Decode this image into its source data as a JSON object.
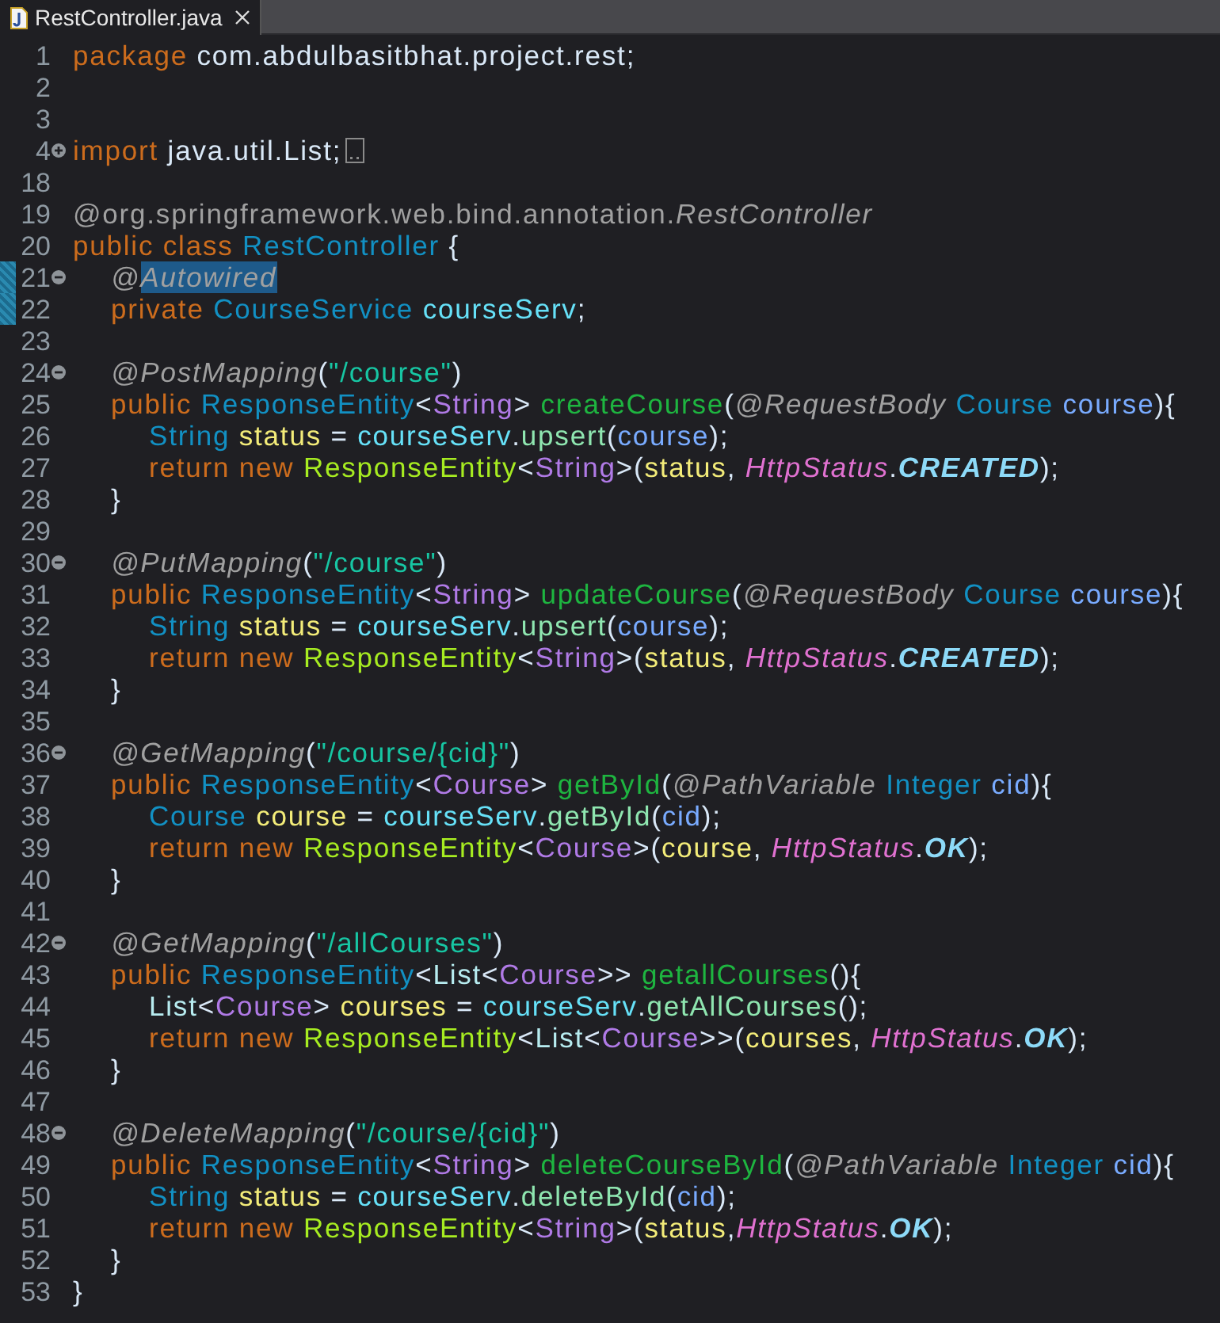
{
  "tab": {
    "title": "RestController.java",
    "selected": true
  },
  "lines": [
    {
      "number": "1",
      "kind": "top",
      "tokens": [
        {
          "text": "package ",
          "kind": "keyword"
        },
        {
          "text": "com.abdulbasitbhat.project.rest;",
          "kind": "plain"
        }
      ]
    },
    {
      "number": "2",
      "kind": "top"
    },
    {
      "number": "3",
      "kind": "top"
    },
    {
      "number": "4",
      "kind": "top",
      "collapsed": true,
      "tokens": [
        {
          "text": "import ",
          "kind": "keyword"
        },
        {
          "text": "java.util.List;",
          "kind": "plain"
        }
      ]
    },
    {
      "number": "18",
      "kind": "top"
    },
    {
      "number": "19",
      "kind": "top",
      "tokens": [
        {
          "text": "@org.springframework.web.bind.annotation.",
          "kind": "annotation-path"
        },
        {
          "text": "RestController",
          "kind": "annotation"
        }
      ]
    },
    {
      "number": "20",
      "kind": "top",
      "tokens": [
        {
          "text": "public class ",
          "kind": "keyword"
        },
        {
          "text": "RestController",
          "kind": "type"
        },
        {
          "text": " {",
          "kind": "plain"
        }
      ]
    },
    {
      "number": "21",
      "kind": "member",
      "collapsed": false,
      "marked": true,
      "tokens": [
        {
          "text": "@",
          "kind": "annotation"
        },
        {
          "text": "Autowired",
          "kind": "annotation",
          "highlighted": true
        }
      ]
    },
    {
      "number": "22",
      "kind": "member",
      "marked": true,
      "tokens": [
        {
          "text": "private ",
          "kind": "keyword"
        },
        {
          "text": "CourseService ",
          "kind": "type"
        },
        {
          "text": "courseServ",
          "kind": "field"
        },
        {
          "text": ";",
          "kind": "plain"
        }
      ]
    },
    {
      "number": "23",
      "kind": "top"
    },
    {
      "number": "24",
      "kind": "member",
      "collapsed": false,
      "tokens": [
        {
          "text": "@PostMapping",
          "kind": "annotation"
        },
        {
          "text": "(",
          "kind": "plain"
        },
        {
          "text": "\"/course\"",
          "kind": "string"
        },
        {
          "text": ")",
          "kind": "plain"
        }
      ]
    },
    {
      "number": "25",
      "kind": "member",
      "tokens": [
        {
          "text": "public ",
          "kind": "keyword"
        },
        {
          "text": "ResponseEntity",
          "kind": "type"
        },
        {
          "text": "<",
          "kind": "plain"
        },
        {
          "text": "String",
          "kind": "generic"
        },
        {
          "text": "> ",
          "kind": "plain"
        },
        {
          "text": "createCourse",
          "kind": "method"
        },
        {
          "text": "(",
          "kind": "plain"
        },
        {
          "text": "@RequestBody ",
          "kind": "annotation"
        },
        {
          "text": "Course ",
          "kind": "type"
        },
        {
          "text": "course",
          "kind": "param"
        },
        {
          "text": "){",
          "kind": "plain"
        }
      ]
    },
    {
      "number": "26",
      "kind": "statement",
      "tokens": [
        {
          "text": "String ",
          "kind": "type"
        },
        {
          "text": "status",
          "kind": "variable"
        },
        {
          "text": " = ",
          "kind": "plain"
        },
        {
          "text": "courseServ",
          "kind": "field"
        },
        {
          "text": ".",
          "kind": "plain"
        },
        {
          "text": "upsert",
          "kind": "call"
        },
        {
          "text": "(",
          "kind": "plain"
        },
        {
          "text": "course",
          "kind": "param"
        },
        {
          "text": ");",
          "kind": "plain"
        }
      ]
    },
    {
      "number": "27",
      "kind": "statement",
      "tokens": [
        {
          "text": "return new ",
          "kind": "keyword"
        },
        {
          "text": "ResponseEntity",
          "kind": "constructor"
        },
        {
          "text": "<",
          "kind": "plain"
        },
        {
          "text": "String",
          "kind": "generic"
        },
        {
          "text": ">(",
          "kind": "plain"
        },
        {
          "text": "status",
          "kind": "variable"
        },
        {
          "text": ", ",
          "kind": "plain"
        },
        {
          "text": "HttpStatus",
          "kind": "static"
        },
        {
          "text": ".",
          "kind": "plain"
        },
        {
          "text": "CREATED",
          "kind": "constant"
        },
        {
          "text": ");",
          "kind": "plain"
        }
      ]
    },
    {
      "number": "28",
      "kind": "member",
      "tokens": [
        {
          "text": "}",
          "kind": "plain"
        }
      ]
    },
    {
      "number": "29",
      "kind": "top"
    },
    {
      "number": "30",
      "kind": "member",
      "collapsed": false,
      "tokens": [
        {
          "text": "@PutMapping",
          "kind": "annotation"
        },
        {
          "text": "(",
          "kind": "plain"
        },
        {
          "text": "\"/course\"",
          "kind": "string"
        },
        {
          "text": ")",
          "kind": "plain"
        }
      ]
    },
    {
      "number": "31",
      "kind": "member",
      "tokens": [
        {
          "text": "public ",
          "kind": "keyword"
        },
        {
          "text": "ResponseEntity",
          "kind": "type"
        },
        {
          "text": "<",
          "kind": "plain"
        },
        {
          "text": "String",
          "kind": "generic"
        },
        {
          "text": "> ",
          "kind": "plain"
        },
        {
          "text": "updateCourse",
          "kind": "method"
        },
        {
          "text": "(",
          "kind": "plain"
        },
        {
          "text": "@RequestBody ",
          "kind": "annotation"
        },
        {
          "text": "Course ",
          "kind": "type"
        },
        {
          "text": "course",
          "kind": "param"
        },
        {
          "text": "){",
          "kind": "plain"
        }
      ]
    },
    {
      "number": "32",
      "kind": "statement",
      "tokens": [
        {
          "text": "String ",
          "kind": "type"
        },
        {
          "text": "status",
          "kind": "variable"
        },
        {
          "text": " = ",
          "kind": "plain"
        },
        {
          "text": "courseServ",
          "kind": "field"
        },
        {
          "text": ".",
          "kind": "plain"
        },
        {
          "text": "upsert",
          "kind": "call"
        },
        {
          "text": "(",
          "kind": "plain"
        },
        {
          "text": "course",
          "kind": "param"
        },
        {
          "text": ");",
          "kind": "plain"
        }
      ]
    },
    {
      "number": "33",
      "kind": "statement",
      "tokens": [
        {
          "text": "return new ",
          "kind": "keyword"
        },
        {
          "text": "ResponseEntity",
          "kind": "constructor"
        },
        {
          "text": "<",
          "kind": "plain"
        },
        {
          "text": "String",
          "kind": "generic"
        },
        {
          "text": ">(",
          "kind": "plain"
        },
        {
          "text": "status",
          "kind": "variable"
        },
        {
          "text": ", ",
          "kind": "plain"
        },
        {
          "text": "HttpStatus",
          "kind": "static"
        },
        {
          "text": ".",
          "kind": "plain"
        },
        {
          "text": "CREATED",
          "kind": "constant"
        },
        {
          "text": ");",
          "kind": "plain"
        }
      ]
    },
    {
      "number": "34",
      "kind": "member",
      "tokens": [
        {
          "text": "}",
          "kind": "plain"
        }
      ]
    },
    {
      "number": "35",
      "kind": "top"
    },
    {
      "number": "36",
      "kind": "member",
      "collapsed": false,
      "tokens": [
        {
          "text": "@GetMapping",
          "kind": "annotation"
        },
        {
          "text": "(",
          "kind": "plain"
        },
        {
          "text": "\"/course/{cid}\"",
          "kind": "string"
        },
        {
          "text": ")",
          "kind": "plain"
        }
      ]
    },
    {
      "number": "37",
      "kind": "member",
      "tokens": [
        {
          "text": "public ",
          "kind": "keyword"
        },
        {
          "text": "ResponseEntity",
          "kind": "type"
        },
        {
          "text": "<",
          "kind": "plain"
        },
        {
          "text": "Course",
          "kind": "generic"
        },
        {
          "text": "> ",
          "kind": "plain"
        },
        {
          "text": "getById",
          "kind": "method"
        },
        {
          "text": "(",
          "kind": "plain"
        },
        {
          "text": "@PathVariable ",
          "kind": "annotation"
        },
        {
          "text": "Integer ",
          "kind": "type"
        },
        {
          "text": "cid",
          "kind": "param"
        },
        {
          "text": "){",
          "kind": "plain"
        }
      ]
    },
    {
      "number": "38",
      "kind": "statement",
      "tokens": [
        {
          "text": "Course ",
          "kind": "type"
        },
        {
          "text": "course",
          "kind": "variable"
        },
        {
          "text": " = ",
          "kind": "plain"
        },
        {
          "text": "courseServ",
          "kind": "field"
        },
        {
          "text": ".",
          "kind": "plain"
        },
        {
          "text": "getById",
          "kind": "call"
        },
        {
          "text": "(",
          "kind": "plain"
        },
        {
          "text": "cid",
          "kind": "param"
        },
        {
          "text": ");",
          "kind": "plain"
        }
      ]
    },
    {
      "number": "39",
      "kind": "statement",
      "tokens": [
        {
          "text": "return new ",
          "kind": "keyword"
        },
        {
          "text": "ResponseEntity",
          "kind": "constructor"
        },
        {
          "text": "<",
          "kind": "plain"
        },
        {
          "text": "Course",
          "kind": "generic"
        },
        {
          "text": ">(",
          "kind": "plain"
        },
        {
          "text": "course",
          "kind": "variable"
        },
        {
          "text": ", ",
          "kind": "plain"
        },
        {
          "text": "HttpStatus",
          "kind": "static"
        },
        {
          "text": ".",
          "kind": "plain"
        },
        {
          "text": "OK",
          "kind": "constant"
        },
        {
          "text": ");",
          "kind": "plain"
        }
      ]
    },
    {
      "number": "40",
      "kind": "member",
      "tokens": [
        {
          "text": "}",
          "kind": "plain"
        }
      ]
    },
    {
      "number": "41",
      "kind": "top"
    },
    {
      "number": "42",
      "kind": "member",
      "collapsed": false,
      "tokens": [
        {
          "text": "@GetMapping",
          "kind": "annotation"
        },
        {
          "text": "(",
          "kind": "plain"
        },
        {
          "text": "\"/allCourses\"",
          "kind": "string"
        },
        {
          "text": ")",
          "kind": "plain"
        }
      ]
    },
    {
      "number": "43",
      "kind": "member",
      "tokens": [
        {
          "text": "public ",
          "kind": "keyword"
        },
        {
          "text": "ResponseEntity",
          "kind": "type"
        },
        {
          "text": "<",
          "kind": "plain"
        },
        {
          "text": "List",
          "kind": "interface"
        },
        {
          "text": "<",
          "kind": "plain"
        },
        {
          "text": "Course",
          "kind": "generic"
        },
        {
          "text": ">> ",
          "kind": "plain"
        },
        {
          "text": "getallCourses",
          "kind": "method"
        },
        {
          "text": "(){",
          "kind": "plain"
        }
      ]
    },
    {
      "number": "44",
      "kind": "statement",
      "tokens": [
        {
          "text": "List",
          "kind": "interface"
        },
        {
          "text": "<",
          "kind": "plain"
        },
        {
          "text": "Course",
          "kind": "generic"
        },
        {
          "text": "> ",
          "kind": "plain"
        },
        {
          "text": "courses",
          "kind": "variable"
        },
        {
          "text": " = ",
          "kind": "plain"
        },
        {
          "text": "courseServ",
          "kind": "field"
        },
        {
          "text": ".",
          "kind": "plain"
        },
        {
          "text": "getAllCourses",
          "kind": "call"
        },
        {
          "text": "();",
          "kind": "plain"
        }
      ]
    },
    {
      "number": "45",
      "kind": "statement",
      "tokens": [
        {
          "text": "return new ",
          "kind": "keyword"
        },
        {
          "text": "ResponseEntity",
          "kind": "constructor"
        },
        {
          "text": "<",
          "kind": "plain"
        },
        {
          "text": "List",
          "kind": "interface"
        },
        {
          "text": "<",
          "kind": "plain"
        },
        {
          "text": "Course",
          "kind": "generic"
        },
        {
          "text": ">>(",
          "kind": "plain"
        },
        {
          "text": "courses",
          "kind": "variable"
        },
        {
          "text": ", ",
          "kind": "plain"
        },
        {
          "text": "HttpStatus",
          "kind": "static"
        },
        {
          "text": ".",
          "kind": "plain"
        },
        {
          "text": "OK",
          "kind": "constant"
        },
        {
          "text": ");",
          "kind": "plain"
        }
      ]
    },
    {
      "number": "46",
      "kind": "member",
      "tokens": [
        {
          "text": "}",
          "kind": "plain"
        }
      ]
    },
    {
      "number": "47",
      "kind": "top"
    },
    {
      "number": "48",
      "kind": "member",
      "collapsed": false,
      "tokens": [
        {
          "text": "@DeleteMapping",
          "kind": "annotation"
        },
        {
          "text": "(",
          "kind": "plain"
        },
        {
          "text": "\"/course/{cid}\"",
          "kind": "string"
        },
        {
          "text": ")",
          "kind": "plain"
        }
      ]
    },
    {
      "number": "49",
      "kind": "member",
      "tokens": [
        {
          "text": "public ",
          "kind": "keyword"
        },
        {
          "text": "ResponseEntity",
          "kind": "type"
        },
        {
          "text": "<",
          "kind": "plain"
        },
        {
          "text": "String",
          "kind": "generic"
        },
        {
          "text": "> ",
          "kind": "plain"
        },
        {
          "text": "deleteCourseById",
          "kind": "method"
        },
        {
          "text": "(",
          "kind": "plain"
        },
        {
          "text": "@PathVariable ",
          "kind": "annotation"
        },
        {
          "text": "Integer ",
          "kind": "type"
        },
        {
          "text": "cid",
          "kind": "param"
        },
        {
          "text": "){",
          "kind": "plain"
        }
      ]
    },
    {
      "number": "50",
      "kind": "statement",
      "tokens": [
        {
          "text": "String ",
          "kind": "type"
        },
        {
          "text": "status",
          "kind": "variable"
        },
        {
          "text": " = ",
          "kind": "plain"
        },
        {
          "text": "courseServ",
          "kind": "field"
        },
        {
          "text": ".",
          "kind": "plain"
        },
        {
          "text": "deleteById",
          "kind": "call"
        },
        {
          "text": "(",
          "kind": "plain"
        },
        {
          "text": "cid",
          "kind": "param"
        },
        {
          "text": ");",
          "kind": "plain"
        }
      ]
    },
    {
      "number": "51",
      "kind": "statement",
      "tokens": [
        {
          "text": "return new ",
          "kind": "keyword"
        },
        {
          "text": "ResponseEntity",
          "kind": "constructor"
        },
        {
          "text": "<",
          "kind": "plain"
        },
        {
          "text": "String",
          "kind": "generic"
        },
        {
          "text": ">(",
          "kind": "plain"
        },
        {
          "text": "status",
          "kind": "variable"
        },
        {
          "text": ",",
          "kind": "plain"
        },
        {
          "text": "HttpStatus",
          "kind": "static"
        },
        {
          "text": ".",
          "kind": "plain"
        },
        {
          "text": "OK",
          "kind": "constant"
        },
        {
          "text": ");",
          "kind": "plain"
        }
      ]
    },
    {
      "number": "52",
      "kind": "member",
      "tokens": [
        {
          "text": "}",
          "kind": "plain"
        }
      ]
    },
    {
      "number": "53",
      "kind": "top",
      "tokens": [
        {
          "text": "}",
          "kind": "plain"
        }
      ]
    }
  ]
}
